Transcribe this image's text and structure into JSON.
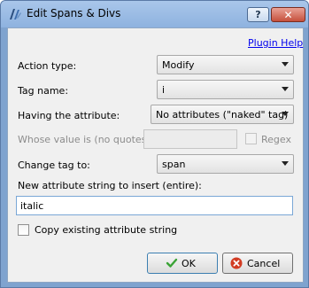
{
  "window": {
    "title": "Edit Spans & Divs"
  },
  "titlebar": {
    "help_label": "?",
    "close_label": "✕"
  },
  "links": {
    "plugin_help": "Plugin Help"
  },
  "form": {
    "action_type": {
      "label": "Action type:",
      "value": "Modify"
    },
    "tag_name": {
      "label": "Tag name:",
      "value": "i"
    },
    "having_attribute": {
      "label": "Having the attribute:",
      "value": "No attributes (\"naked\" tag)"
    },
    "whose_value": {
      "label": "Whose value is (no quotes):",
      "value": ""
    },
    "regex": {
      "label": "Regex",
      "checked": false
    },
    "change_tag": {
      "label": "Change tag to:",
      "value": "span"
    },
    "new_attribute": {
      "label": "New attribute string to insert (entire):",
      "value": "italic"
    },
    "copy_existing": {
      "label": "Copy existing attribute string",
      "checked": false
    }
  },
  "buttons": {
    "ok_label": "OK",
    "cancel_label": "Cancel"
  },
  "colors": {
    "link": "#0000ee",
    "ok_icon": "#3aa335",
    "cancel_icon": "#d23b22",
    "titlebar": "#9dbde6"
  }
}
